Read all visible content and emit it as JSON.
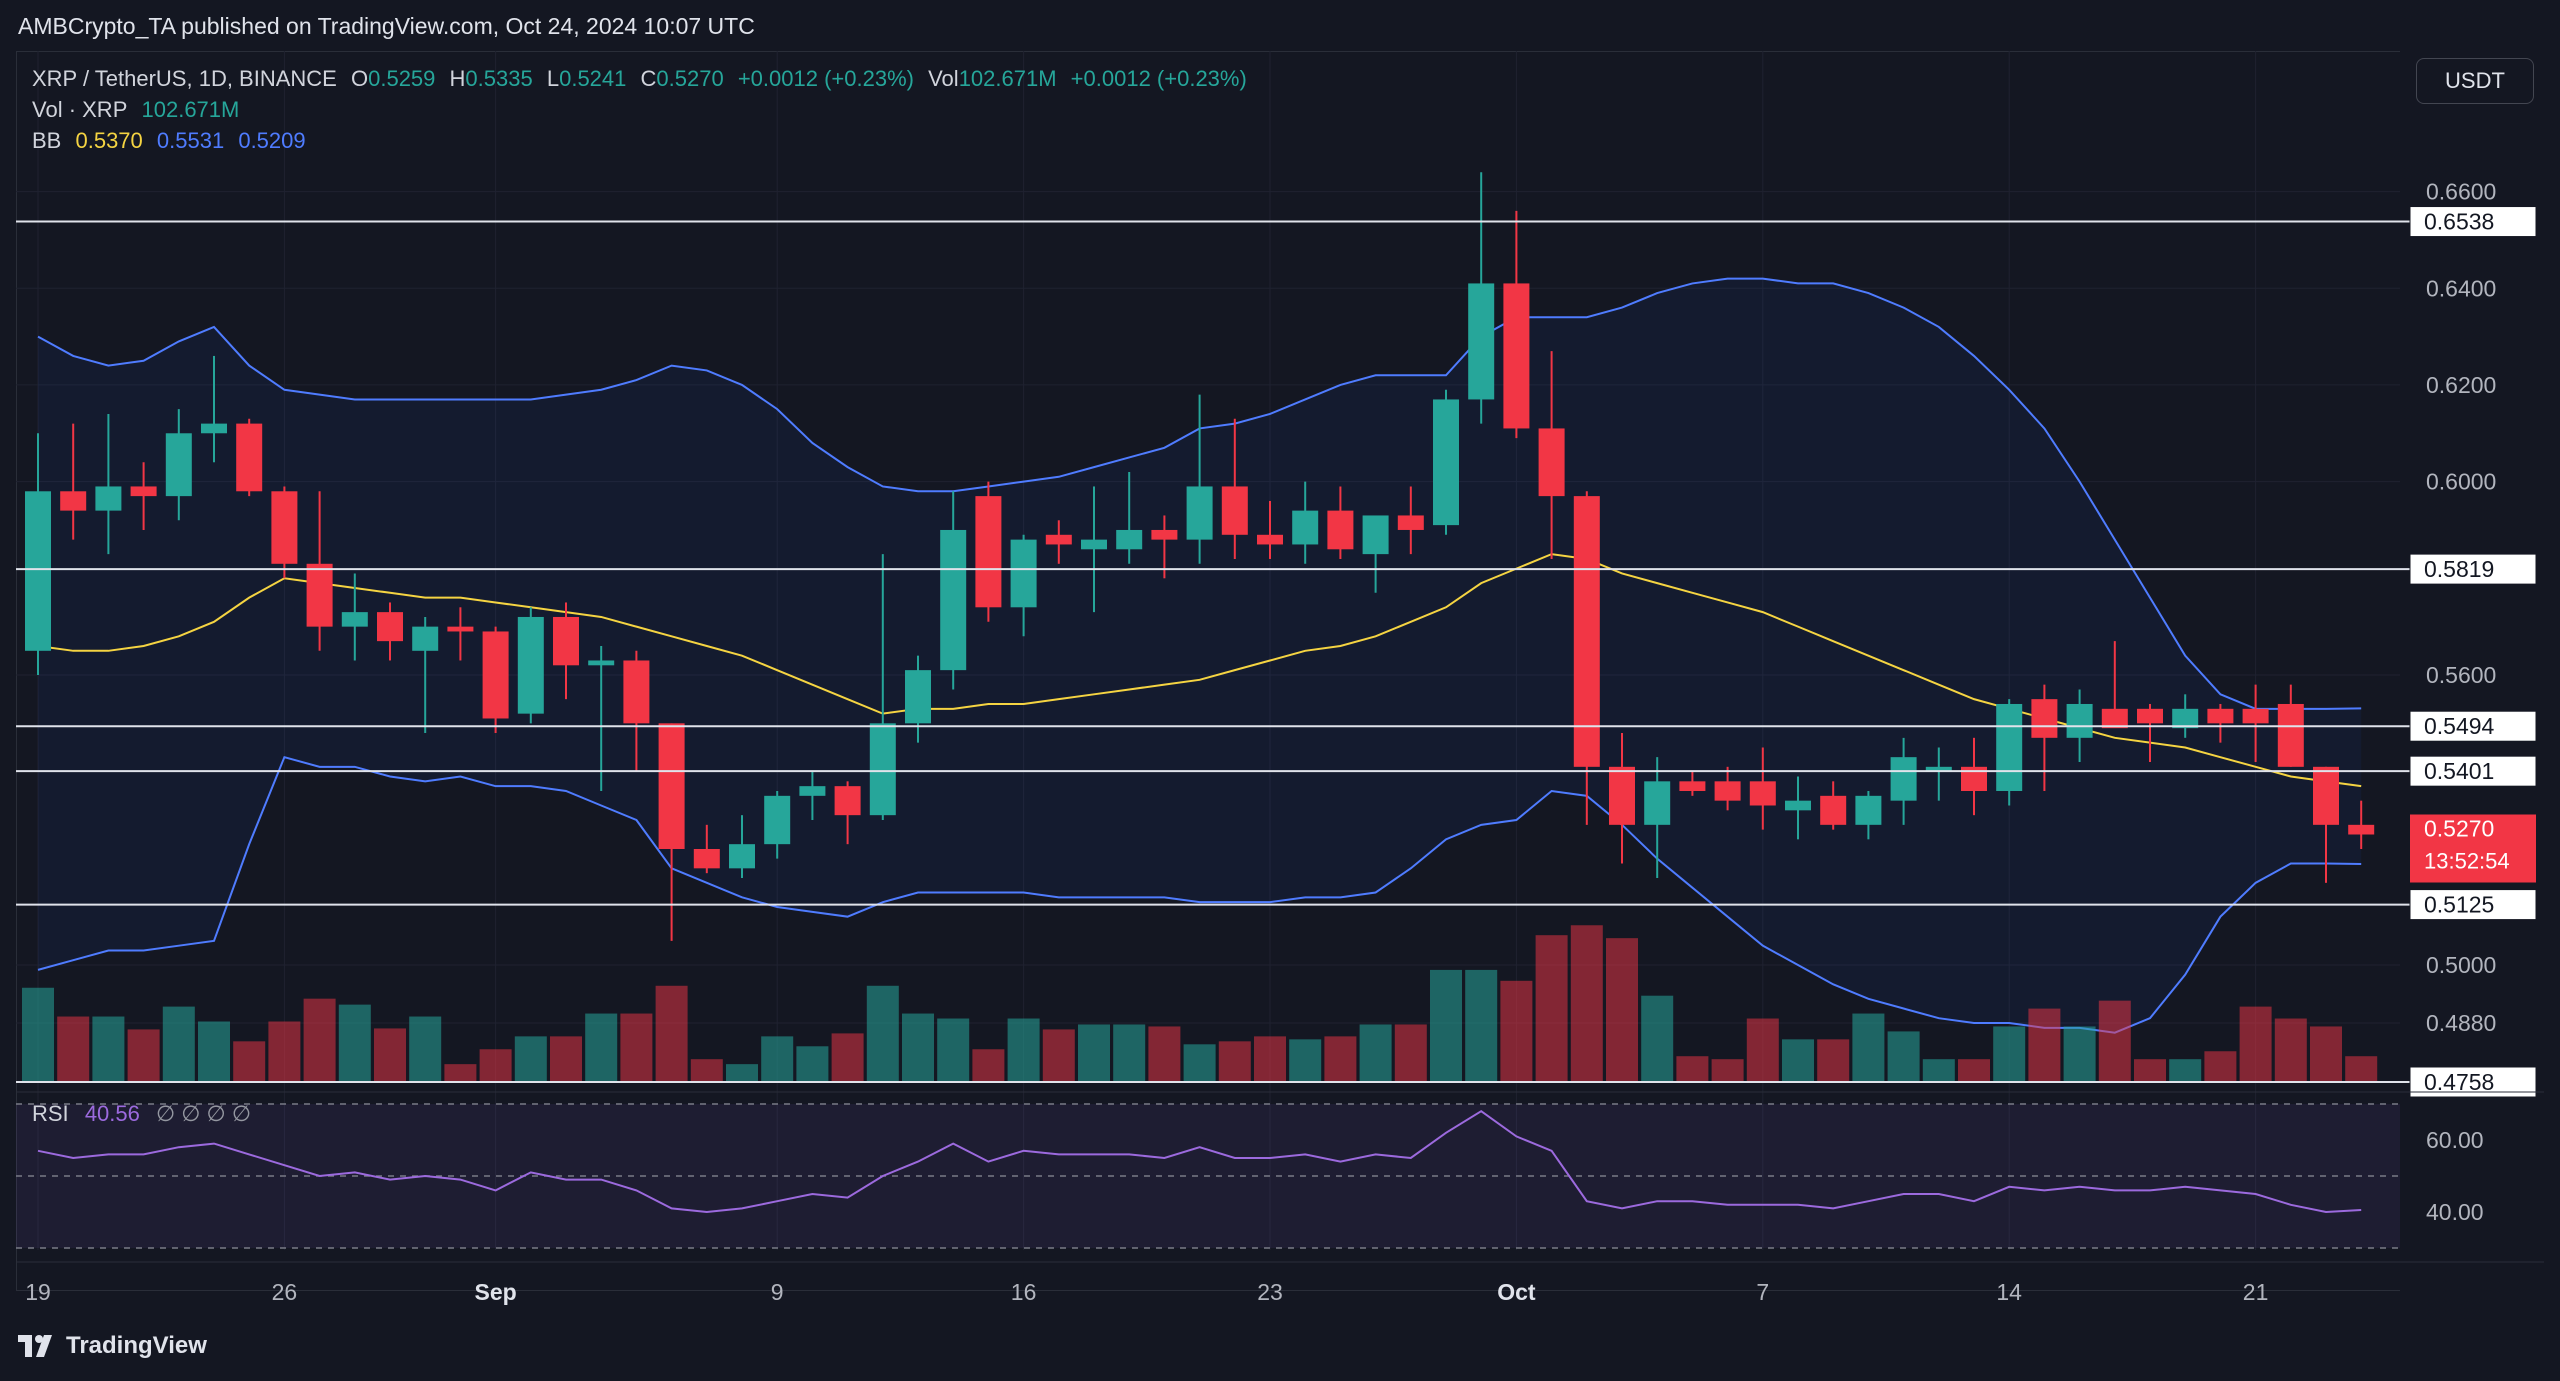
{
  "header": {
    "publisher": "AMBCrypto_TA published on TradingView.com, Oct 24, 2024 10:07 UTC"
  },
  "legend": {
    "symbol": "XRP / TetherUS, 1D, BINANCE",
    "o_label": "O",
    "o": "0.5259",
    "h_label": "H",
    "h": "0.5335",
    "l_label": "L",
    "l": "0.5241",
    "c_label": "C",
    "c": "0.5270",
    "change": "+0.0012 (+0.23%)",
    "vol_label": "Vol",
    "vol": "102.671M",
    "vol_change": "+0.0012 (+0.23%)",
    "vol_row_label": "Vol · XRP",
    "vol_row_value": "102.671M",
    "bb_label": "BB",
    "bb_mid": "0.5370",
    "bb_upper": "0.5531",
    "bb_lower": "0.5209"
  },
  "currency_button": "USDT",
  "rsi": {
    "label": "RSI",
    "value": "40.56",
    "symbols": "∅ ∅ ∅ ∅"
  },
  "brand": "TradingView",
  "colors": {
    "up": "#26a69a",
    "down": "#f23645",
    "bb_mid": "#f5d442",
    "bb_band": "#4f7cff",
    "rsi": "#9c6ade",
    "bg": "#141722"
  },
  "chart_data": {
    "type": "candlestick",
    "symbol": "XRP / TetherUS",
    "interval": "1D",
    "exchange": "BINANCE",
    "x_ticks": [
      "19",
      "26",
      "Sep",
      "9",
      "16",
      "23",
      "Oct",
      "7",
      "14",
      "21"
    ],
    "y_ticks": [
      "0.6600",
      "0.6400",
      "0.6200",
      "0.6000",
      "0.5600",
      "0.5000",
      "0.4880"
    ],
    "y_range": [
      0.4758,
      0.665
    ],
    "horizontal_levels": [
      "0.6538",
      "0.5819",
      "0.5494",
      "0.5401",
      "0.5125",
      "0.4758"
    ],
    "last_price_tag": {
      "price": "0.5270",
      "countdown": "13:52:54"
    },
    "candles": [
      {
        "o": 0.565,
        "h": 0.61,
        "l": 0.56,
        "c": 0.598,
        "v": 0.95,
        "bbm": 0.566,
        "bbu": 0.63,
        "bbl": 0.499,
        "rsi": 57
      },
      {
        "o": 0.598,
        "h": 0.612,
        "l": 0.588,
        "c": 0.594,
        "v": 0.66,
        "bbm": 0.565,
        "bbu": 0.626,
        "bbl": 0.501,
        "rsi": 55
      },
      {
        "o": 0.594,
        "h": 0.614,
        "l": 0.585,
        "c": 0.599,
        "v": 0.66,
        "bbm": 0.565,
        "bbu": 0.624,
        "bbl": 0.503,
        "rsi": 56
      },
      {
        "o": 0.599,
        "h": 0.604,
        "l": 0.59,
        "c": 0.597,
        "v": 0.53,
        "bbm": 0.566,
        "bbu": 0.625,
        "bbl": 0.503,
        "rsi": 56
      },
      {
        "o": 0.597,
        "h": 0.615,
        "l": 0.592,
        "c": 0.61,
        "v": 0.76,
        "bbm": 0.568,
        "bbu": 0.629,
        "bbl": 0.504,
        "rsi": 58
      },
      {
        "o": 0.61,
        "h": 0.626,
        "l": 0.604,
        "c": 0.612,
        "v": 0.61,
        "bbm": 0.571,
        "bbu": 0.632,
        "bbl": 0.505,
        "rsi": 59
      },
      {
        "o": 0.612,
        "h": 0.613,
        "l": 0.597,
        "c": 0.598,
        "v": 0.41,
        "bbm": 0.576,
        "bbu": 0.624,
        "bbl": 0.525,
        "rsi": 56
      },
      {
        "o": 0.598,
        "h": 0.599,
        "l": 0.58,
        "c": 0.583,
        "v": 0.61,
        "bbm": 0.58,
        "bbu": 0.619,
        "bbl": 0.543,
        "rsi": 53
      },
      {
        "o": 0.583,
        "h": 0.598,
        "l": 0.565,
        "c": 0.57,
        "v": 0.84,
        "bbm": 0.579,
        "bbu": 0.618,
        "bbl": 0.541,
        "rsi": 50
      },
      {
        "o": 0.57,
        "h": 0.581,
        "l": 0.563,
        "c": 0.573,
        "v": 0.78,
        "bbm": 0.578,
        "bbu": 0.617,
        "bbl": 0.541,
        "rsi": 51
      },
      {
        "o": 0.573,
        "h": 0.575,
        "l": 0.563,
        "c": 0.567,
        "v": 0.54,
        "bbm": 0.577,
        "bbu": 0.617,
        "bbl": 0.539,
        "rsi": 49
      },
      {
        "o": 0.565,
        "h": 0.572,
        "l": 0.548,
        "c": 0.57,
        "v": 0.66,
        "bbm": 0.576,
        "bbu": 0.617,
        "bbl": 0.538,
        "rsi": 50
      },
      {
        "o": 0.57,
        "h": 0.574,
        "l": 0.563,
        "c": 0.569,
        "v": 0.18,
        "bbm": 0.576,
        "bbu": 0.617,
        "bbl": 0.539,
        "rsi": 49
      },
      {
        "o": 0.569,
        "h": 0.57,
        "l": 0.548,
        "c": 0.551,
        "v": 0.33,
        "bbm": 0.575,
        "bbu": 0.617,
        "bbl": 0.537,
        "rsi": 46
      },
      {
        "o": 0.552,
        "h": 0.574,
        "l": 0.55,
        "c": 0.572,
        "v": 0.46,
        "bbm": 0.574,
        "bbu": 0.617,
        "bbl": 0.537,
        "rsi": 51
      },
      {
        "o": 0.572,
        "h": 0.575,
        "l": 0.555,
        "c": 0.562,
        "v": 0.46,
        "bbm": 0.573,
        "bbu": 0.618,
        "bbl": 0.536,
        "rsi": 49
      },
      {
        "o": 0.562,
        "h": 0.566,
        "l": 0.536,
        "c": 0.563,
        "v": 0.69,
        "bbm": 0.572,
        "bbu": 0.619,
        "bbl": 0.533,
        "rsi": 49
      },
      {
        "o": 0.563,
        "h": 0.565,
        "l": 0.54,
        "c": 0.55,
        "v": 0.69,
        "bbm": 0.57,
        "bbu": 0.621,
        "bbl": 0.53,
        "rsi": 46
      },
      {
        "o": 0.55,
        "h": 0.55,
        "l": 0.505,
        "c": 0.524,
        "v": 0.97,
        "bbm": 0.568,
        "bbu": 0.624,
        "bbl": 0.52,
        "rsi": 41
      },
      {
        "o": 0.524,
        "h": 0.529,
        "l": 0.519,
        "c": 0.52,
        "v": 0.23,
        "bbm": 0.566,
        "bbu": 0.623,
        "bbl": 0.517,
        "rsi": 40
      },
      {
        "o": 0.52,
        "h": 0.531,
        "l": 0.518,
        "c": 0.525,
        "v": 0.18,
        "bbm": 0.564,
        "bbu": 0.62,
        "bbl": 0.514,
        "rsi": 41
      },
      {
        "o": 0.525,
        "h": 0.536,
        "l": 0.522,
        "c": 0.535,
        "v": 0.46,
        "bbm": 0.561,
        "bbu": 0.615,
        "bbl": 0.512,
        "rsi": 43
      },
      {
        "o": 0.535,
        "h": 0.54,
        "l": 0.53,
        "c": 0.537,
        "v": 0.36,
        "bbm": 0.558,
        "bbu": 0.608,
        "bbl": 0.511,
        "rsi": 45
      },
      {
        "o": 0.537,
        "h": 0.538,
        "l": 0.525,
        "c": 0.531,
        "v": 0.49,
        "bbm": 0.555,
        "bbu": 0.603,
        "bbl": 0.51,
        "rsi": 44
      },
      {
        "o": 0.531,
        "h": 0.585,
        "l": 0.53,
        "c": 0.55,
        "v": 0.97,
        "bbm": 0.552,
        "bbu": 0.599,
        "bbl": 0.513,
        "rsi": 50
      },
      {
        "o": 0.55,
        "h": 0.564,
        "l": 0.546,
        "c": 0.561,
        "v": 0.69,
        "bbm": 0.553,
        "bbu": 0.598,
        "bbl": 0.515,
        "rsi": 54
      },
      {
        "o": 0.561,
        "h": 0.598,
        "l": 0.557,
        "c": 0.59,
        "v": 0.64,
        "bbm": 0.553,
        "bbu": 0.598,
        "bbl": 0.515,
        "rsi": 59
      },
      {
        "o": 0.597,
        "h": 0.6,
        "l": 0.571,
        "c": 0.574,
        "v": 0.33,
        "bbm": 0.554,
        "bbu": 0.599,
        "bbl": 0.515,
        "rsi": 54
      },
      {
        "o": 0.574,
        "h": 0.589,
        "l": 0.568,
        "c": 0.588,
        "v": 0.64,
        "bbm": 0.554,
        "bbu": 0.6,
        "bbl": 0.515,
        "rsi": 57
      },
      {
        "o": 0.589,
        "h": 0.592,
        "l": 0.583,
        "c": 0.587,
        "v": 0.53,
        "bbm": 0.555,
        "bbu": 0.601,
        "bbl": 0.514,
        "rsi": 56
      },
      {
        "o": 0.586,
        "h": 0.599,
        "l": 0.573,
        "c": 0.588,
        "v": 0.58,
        "bbm": 0.556,
        "bbu": 0.603,
        "bbl": 0.514,
        "rsi": 56
      },
      {
        "o": 0.586,
        "h": 0.602,
        "l": 0.583,
        "c": 0.59,
        "v": 0.58,
        "bbm": 0.557,
        "bbu": 0.605,
        "bbl": 0.514,
        "rsi": 56
      },
      {
        "o": 0.59,
        "h": 0.593,
        "l": 0.58,
        "c": 0.588,
        "v": 0.56,
        "bbm": 0.558,
        "bbu": 0.607,
        "bbl": 0.514,
        "rsi": 55
      },
      {
        "o": 0.588,
        "h": 0.618,
        "l": 0.583,
        "c": 0.599,
        "v": 0.38,
        "bbm": 0.559,
        "bbu": 0.611,
        "bbl": 0.513,
        "rsi": 58
      },
      {
        "o": 0.599,
        "h": 0.613,
        "l": 0.584,
        "c": 0.589,
        "v": 0.41,
        "bbm": 0.561,
        "bbu": 0.612,
        "bbl": 0.513,
        "rsi": 55
      },
      {
        "o": 0.589,
        "h": 0.596,
        "l": 0.584,
        "c": 0.587,
        "v": 0.46,
        "bbm": 0.563,
        "bbu": 0.614,
        "bbl": 0.513,
        "rsi": 55
      },
      {
        "o": 0.587,
        "h": 0.6,
        "l": 0.583,
        "c": 0.594,
        "v": 0.43,
        "bbm": 0.565,
        "bbu": 0.617,
        "bbl": 0.514,
        "rsi": 56
      },
      {
        "o": 0.594,
        "h": 0.599,
        "l": 0.584,
        "c": 0.586,
        "v": 0.46,
        "bbm": 0.566,
        "bbu": 0.62,
        "bbl": 0.514,
        "rsi": 54
      },
      {
        "o": 0.585,
        "h": 0.593,
        "l": 0.577,
        "c": 0.593,
        "v": 0.58,
        "bbm": 0.568,
        "bbu": 0.622,
        "bbl": 0.515,
        "rsi": 56
      },
      {
        "o": 0.593,
        "h": 0.599,
        "l": 0.585,
        "c": 0.59,
        "v": 0.58,
        "bbm": 0.571,
        "bbu": 0.622,
        "bbl": 0.52,
        "rsi": 55
      },
      {
        "o": 0.591,
        "h": 0.619,
        "l": 0.589,
        "c": 0.617,
        "v": 1.13,
        "bbm": 0.574,
        "bbu": 0.622,
        "bbl": 0.526,
        "rsi": 62
      },
      {
        "o": 0.617,
        "h": 0.664,
        "l": 0.612,
        "c": 0.641,
        "v": 1.13,
        "bbm": 0.579,
        "bbu": 0.63,
        "bbl": 0.529,
        "rsi": 68
      },
      {
        "o": 0.641,
        "h": 0.656,
        "l": 0.609,
        "c": 0.611,
        "v": 1.02,
        "bbm": 0.582,
        "bbu": 0.634,
        "bbl": 0.53,
        "rsi": 61
      },
      {
        "o": 0.611,
        "h": 0.627,
        "l": 0.584,
        "c": 0.597,
        "v": 1.48,
        "bbm": 0.585,
        "bbu": 0.634,
        "bbl": 0.536,
        "rsi": 57
      },
      {
        "o": 0.597,
        "h": 0.598,
        "l": 0.529,
        "c": 0.541,
        "v": 1.58,
        "bbm": 0.584,
        "bbu": 0.634,
        "bbl": 0.535,
        "rsi": 43
      },
      {
        "o": 0.541,
        "h": 0.548,
        "l": 0.521,
        "c": 0.529,
        "v": 1.45,
        "bbm": 0.581,
        "bbu": 0.636,
        "bbl": 0.529,
        "rsi": 41
      },
      {
        "o": 0.529,
        "h": 0.543,
        "l": 0.518,
        "c": 0.538,
        "v": 0.87,
        "bbm": 0.579,
        "bbu": 0.639,
        "bbl": 0.522,
        "rsi": 43
      },
      {
        "o": 0.538,
        "h": 0.54,
        "l": 0.535,
        "c": 0.536,
        "v": 0.26,
        "bbm": 0.577,
        "bbu": 0.641,
        "bbl": 0.516,
        "rsi": 43
      },
      {
        "o": 0.538,
        "h": 0.541,
        "l": 0.532,
        "c": 0.534,
        "v": 0.23,
        "bbm": 0.575,
        "bbu": 0.642,
        "bbl": 0.51,
        "rsi": 42
      },
      {
        "o": 0.538,
        "h": 0.545,
        "l": 0.528,
        "c": 0.533,
        "v": 0.64,
        "bbm": 0.573,
        "bbu": 0.642,
        "bbl": 0.504,
        "rsi": 42
      },
      {
        "o": 0.532,
        "h": 0.539,
        "l": 0.526,
        "c": 0.534,
        "v": 0.43,
        "bbm": 0.57,
        "bbu": 0.641,
        "bbl": 0.5,
        "rsi": 42
      },
      {
        "o": 0.535,
        "h": 0.538,
        "l": 0.528,
        "c": 0.529,
        "v": 0.43,
        "bbm": 0.567,
        "bbu": 0.641,
        "bbl": 0.496,
        "rsi": 41
      },
      {
        "o": 0.529,
        "h": 0.536,
        "l": 0.526,
        "c": 0.535,
        "v": 0.69,
        "bbm": 0.564,
        "bbu": 0.639,
        "bbl": 0.493,
        "rsi": 43
      },
      {
        "o": 0.534,
        "h": 0.547,
        "l": 0.529,
        "c": 0.543,
        "v": 0.51,
        "bbm": 0.561,
        "bbu": 0.636,
        "bbl": 0.491,
        "rsi": 45
      },
      {
        "o": 0.54,
        "h": 0.545,
        "l": 0.534,
        "c": 0.541,
        "v": 0.23,
        "bbm": 0.558,
        "bbu": 0.632,
        "bbl": 0.489,
        "rsi": 45
      },
      {
        "o": 0.541,
        "h": 0.547,
        "l": 0.531,
        "c": 0.536,
        "v": 0.23,
        "bbm": 0.555,
        "bbu": 0.626,
        "bbl": 0.488,
        "rsi": 43
      },
      {
        "o": 0.536,
        "h": 0.555,
        "l": 0.533,
        "c": 0.554,
        "v": 0.56,
        "bbm": 0.553,
        "bbu": 0.619,
        "bbl": 0.488,
        "rsi": 47
      },
      {
        "o": 0.555,
        "h": 0.558,
        "l": 0.536,
        "c": 0.547,
        "v": 0.74,
        "bbm": 0.551,
        "bbu": 0.611,
        "bbl": 0.487,
        "rsi": 46
      },
      {
        "o": 0.547,
        "h": 0.557,
        "l": 0.542,
        "c": 0.554,
        "v": 0.56,
        "bbm": 0.549,
        "bbu": 0.6,
        "bbl": 0.487,
        "rsi": 47
      },
      {
        "o": 0.553,
        "h": 0.567,
        "l": 0.55,
        "c": 0.549,
        "v": 0.82,
        "bbm": 0.547,
        "bbu": 0.588,
        "bbl": 0.486,
        "rsi": 46
      },
      {
        "o": 0.553,
        "h": 0.554,
        "l": 0.542,
        "c": 0.55,
        "v": 0.23,
        "bbm": 0.546,
        "bbu": 0.576,
        "bbl": 0.489,
        "rsi": 46
      },
      {
        "o": 0.549,
        "h": 0.556,
        "l": 0.547,
        "c": 0.553,
        "v": 0.23,
        "bbm": 0.545,
        "bbu": 0.564,
        "bbl": 0.498,
        "rsi": 47
      },
      {
        "o": 0.553,
        "h": 0.554,
        "l": 0.546,
        "c": 0.55,
        "v": 0.31,
        "bbm": 0.543,
        "bbu": 0.556,
        "bbl": 0.51,
        "rsi": 46
      },
      {
        "o": 0.553,
        "h": 0.558,
        "l": 0.542,
        "c": 0.55,
        "v": 0.76,
        "bbm": 0.541,
        "bbu": 0.553,
        "bbl": 0.517,
        "rsi": 45
      },
      {
        "o": 0.554,
        "h": 0.558,
        "l": 0.541,
        "c": 0.541,
        "v": 0.64,
        "bbm": 0.539,
        "bbu": 0.553,
        "bbl": 0.521,
        "rsi": 42
      },
      {
        "o": 0.541,
        "h": 0.541,
        "l": 0.517,
        "c": 0.529,
        "v": 0.56,
        "bbm": 0.538,
        "bbu": 0.553,
        "bbl": 0.521,
        "rsi": 40
      },
      {
        "o": 0.529,
        "h": 0.534,
        "l": 0.524,
        "c": 0.527,
        "v": 0.26,
        "bbm": 0.537,
        "bbu": 0.5531,
        "bbl": 0.5209,
        "rsi": 40.56
      }
    ],
    "rsi_levels": [
      "60.00",
      "40.00"
    ]
  }
}
